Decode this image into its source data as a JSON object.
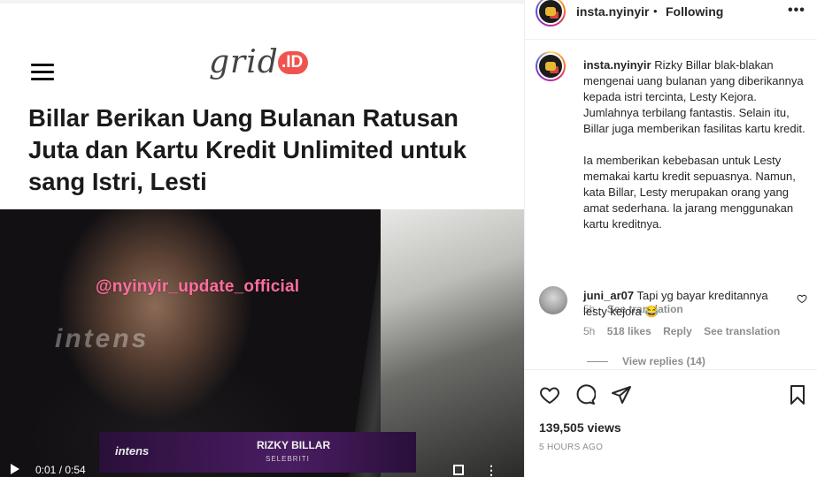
{
  "media": {
    "logo_text": "grid",
    "logo_badge": ".ID",
    "headline": "Billar Berikan Uang Bulanan Ratusan Juta dan Kartu Kredit Unlimited untuk sang Istri, Lesti",
    "watermark": "@nyinyir_update_official",
    "channel_watermark": "intens",
    "lower_third": {
      "brand": "intens",
      "name": "RIZKY BILLAR",
      "role": "SELEBRITI"
    },
    "time": "0:01 / 0:54"
  },
  "header": {
    "username": "insta.nyinyir",
    "separator": "•",
    "follow_label": "Following",
    "more": "•••"
  },
  "caption": {
    "username": "insta.nyinyir",
    "paragraph1": "Rizky Billar blak-blakan mengenai uang bulanan yang diberikannya kepada istri tercinta, Lesty Kejora. Jumlahnya terbilang fantastis. Selain itu, Billar juga memberikan fasilitas kartu kredit.",
    "paragraph2": "Ia memberikan kebebasan untuk Lesty memakai kartu kredit sepuasnya. Namun, kata Billar, Lesty merupakan orang yang amat sederhana. la jarang menggunakan kartu kreditnya.",
    "age": "5h",
    "translation": "See translation"
  },
  "comment": {
    "username": "juni_ar07",
    "text": "Tapi yg bayar kreditannya lesty kejora 😂",
    "age": "5h",
    "likes": "518 likes",
    "reply": "Reply",
    "translation": "See translation",
    "view_replies": "View replies (14)"
  },
  "stats": {
    "views": "139,505 views",
    "ago": "5 HOURS AGO"
  }
}
